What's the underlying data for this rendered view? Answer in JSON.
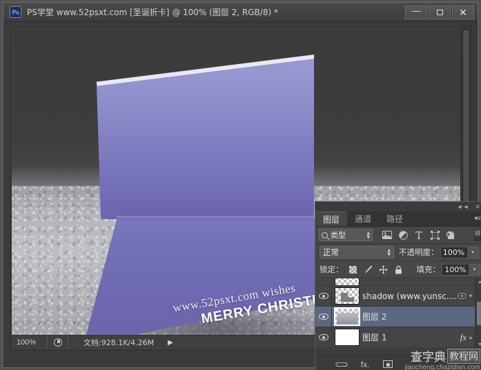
{
  "window": {
    "app_badge": "Ps",
    "title": "PS学堂 www.52psxt.com [圣诞折卡] @ 100% (图层 2, RGB/8) *",
    "minimize_label": "—",
    "maximize_label": "",
    "close_label": "✕"
  },
  "canvas": {
    "card_line1": "www.52psxt.com  wishes",
    "card_line2": "MERRY CHRISTMAS",
    "card_gradient_top": "#9b9bd2",
    "card_gradient_bottom": "#6a64aa"
  },
  "statusbar": {
    "zoom": "100%",
    "preview_icon": "document-preview-icon",
    "doc_info": "文档:928.1K/4.26M",
    "expand_arrow": "▶"
  },
  "panel": {
    "collapse_icon": "◄◄",
    "close_icon": "✕",
    "menu_icon": "▾≡",
    "tabs": [
      {
        "label": "图层",
        "active": true,
        "name": "tab-layers"
      },
      {
        "label": "通道",
        "active": false,
        "name": "tab-channels"
      },
      {
        "label": "路径",
        "active": false,
        "name": "tab-paths"
      }
    ],
    "filter": {
      "search_icon": "search-icon",
      "type_label": "类型",
      "icons": [
        "pixel-layer-filter-icon",
        "adjustment-layer-filter-icon",
        "type-layer-filter-icon",
        "shape-layer-filter-icon",
        "smart-object-filter-icon"
      ],
      "toggle_name": "filter-enable-toggle"
    },
    "blend": {
      "mode": "正常",
      "opacity_label": "不透明度：",
      "opacity_value": "100%",
      "dropdown_caret": "▾"
    },
    "lock": {
      "label": "锁定：",
      "icons": [
        "lock-transparent-pixels-icon",
        "lock-image-pixels-icon",
        "lock-position-icon",
        "lock-all-icon"
      ],
      "fill_label": "填充：",
      "fill_value": "100%",
      "dropdown_caret": "▾"
    },
    "layers": [
      {
        "name": "",
        "partial": true,
        "selected": false,
        "thumb": "partial",
        "visible": true,
        "has_fx": false,
        "has_eye_marker": false
      },
      {
        "name": "shadow (www.yunsc....",
        "partial": false,
        "selected": false,
        "thumb": "checker-shadow",
        "visible": true,
        "has_fx": false,
        "has_eye_marker": true
      },
      {
        "name": "图层 2",
        "partial": false,
        "selected": true,
        "thumb": "card-image",
        "visible": true,
        "has_fx": false,
        "has_eye_marker": false
      },
      {
        "name": "图层 1",
        "partial": false,
        "selected": false,
        "thumb": "white",
        "visible": true,
        "has_fx": true,
        "has_eye_marker": false
      }
    ],
    "scroll": {
      "up": "▲",
      "down": "▼"
    },
    "bottom_buttons": [
      {
        "name": "link-layers-button",
        "label": "⊂⊃"
      },
      {
        "name": "layer-style-fx-button",
        "label": "fx."
      },
      {
        "name": "add-layer-mask-button",
        "label": ""
      }
    ]
  },
  "watermark": {
    "text_main": "查字典",
    "text_box": "教程网",
    "url": "jiaocheng.chazidian.com"
  }
}
